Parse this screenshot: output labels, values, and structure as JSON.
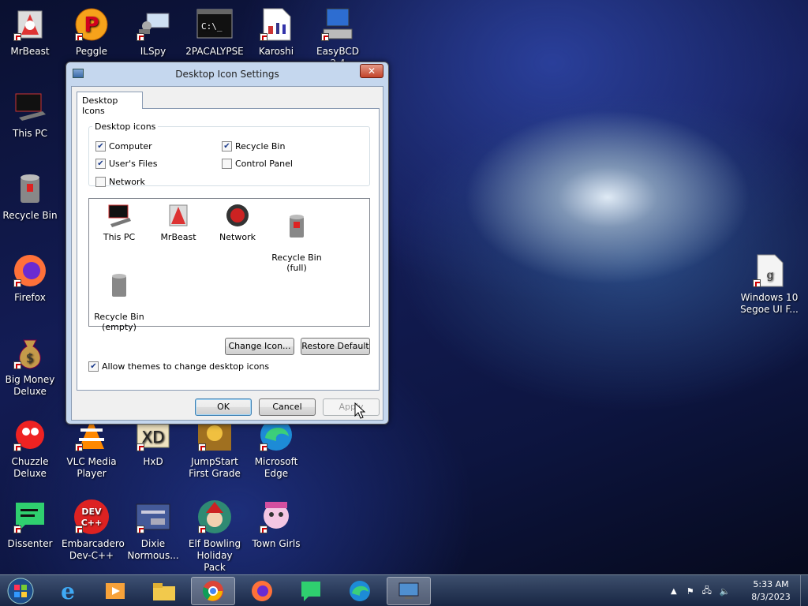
{
  "desktop_icons": [
    {
      "label": "MrBeast",
      "icon": "mrbeast-icon"
    },
    {
      "label": "Peggle",
      "icon": "peggle-icon"
    },
    {
      "label": "ILSpy",
      "icon": "ilspy-icon"
    },
    {
      "label": "2PACALYPSE",
      "icon": "terminal-icon"
    },
    {
      "label": "Karoshi",
      "icon": "karoshi-icon"
    },
    {
      "label": "EasyBCD 2.4",
      "icon": "easybcd-icon"
    },
    {
      "label": "This PC",
      "icon": "this-pc-icon"
    },
    {
      "label": "Recycle Bin",
      "icon": "recycle-bin-icon"
    },
    {
      "label": "Firefox",
      "icon": "firefox-icon"
    },
    {
      "label": "Big Money Deluxe",
      "icon": "money-bag-icon"
    },
    {
      "label": "Chuzzle Deluxe",
      "icon": "chuzzle-icon"
    },
    {
      "label": "VLC Media Player",
      "icon": "vlc-icon"
    },
    {
      "label": "HxD",
      "icon": "hxd-icon"
    },
    {
      "label": "JumpStart First Grade",
      "icon": "jumpstart-icon"
    },
    {
      "label": "Microsoft Edge",
      "icon": "edge-icon"
    },
    {
      "label": "Dissenter",
      "icon": "dissenter-icon"
    },
    {
      "label": "Embarcadero Dev-C++",
      "icon": "devcpp-icon"
    },
    {
      "label": "Dixie Normous...",
      "icon": "dixie-icon"
    },
    {
      "label": "Elf Bowling Holiday Pack",
      "icon": "elf-bowling-icon"
    },
    {
      "label": "Town Girls",
      "icon": "town-girls-icon"
    },
    {
      "label": "Windows 10 Segoe UI F...",
      "icon": "font-file-icon"
    }
  ],
  "dialog": {
    "title": "Desktop Icon Settings",
    "close_label": "✕",
    "tab": "Desktop Icons",
    "group_label": "Desktop icons",
    "checks": [
      {
        "label": "Computer",
        "checked": true
      },
      {
        "label": "Recycle Bin",
        "checked": true
      },
      {
        "label": "User's Files",
        "checked": true
      },
      {
        "label": "Control Panel",
        "checked": false
      },
      {
        "label": "Network",
        "checked": false
      }
    ],
    "list_items": [
      {
        "label": "This PC",
        "icon": "this-pc-icon"
      },
      {
        "label": "MrBeast",
        "icon": "mrbeast-icon"
      },
      {
        "label": "Network",
        "icon": "network-icon"
      },
      {
        "label": "Recycle Bin\n(full)",
        "icon": "recycle-bin-full-icon"
      },
      {
        "label": "Recycle Bin\n(empty)",
        "icon": "recycle-bin-empty-icon"
      }
    ],
    "change_icon": "Change Icon...",
    "restore_default": "Restore Default",
    "allow_themes": "Allow themes to change desktop icons",
    "allow_themes_checked": true,
    "ok": "OK",
    "cancel": "Cancel",
    "apply": "Apply"
  },
  "taskbar": {
    "items": [
      "start-orb-icon",
      "ie-icon",
      "media-player-icon",
      "explorer-folder-icon",
      "chrome-icon",
      "firefox-icon",
      "dissenter-icon",
      "edge-icon",
      "desktop-settings-icon"
    ],
    "time": "5:33 AM",
    "date": "8/3/2023"
  },
  "colors": {
    "accent": "#3c7fb1",
    "close": "#c2432a"
  }
}
